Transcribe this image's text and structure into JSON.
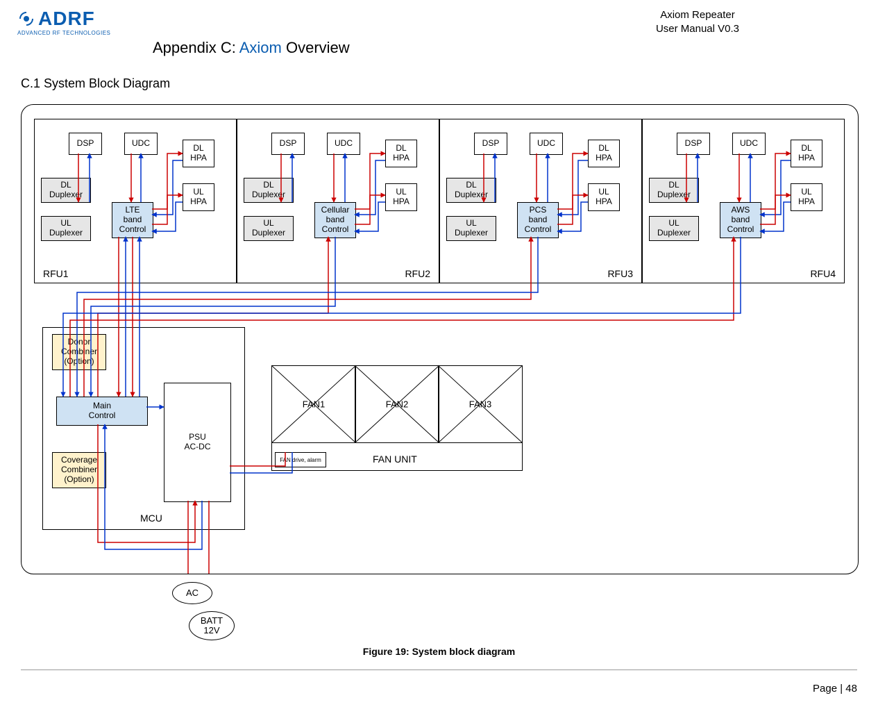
{
  "header": {
    "brand": "ADRF",
    "brand_tag": "ADVANCED RF TECHNOLOGIES",
    "doc_title": "Axiom Repeater",
    "doc_subtitle": "User Manual V0.3"
  },
  "appendix": {
    "prefix": "Appendix C: ",
    "highlight": "Axiom",
    "suffix": " Overview"
  },
  "section": {
    "title": "C.1 System Block Diagram"
  },
  "rfu_common": {
    "dsp": "DSP",
    "udc": "UDC",
    "dl_hpa": "DL\nHPA",
    "ul_hpa": "UL\nHPA",
    "dl_dup": "DL\nDuplexer",
    "ul_dup": "UL\nDuplexer"
  },
  "rfu": [
    {
      "label": "RFU1",
      "band_control": "LTE\nband\nControl"
    },
    {
      "label": "RFU2",
      "band_control": "Cellular\nband\nControl"
    },
    {
      "label": "RFU3",
      "band_control": "PCS\nband\nControl"
    },
    {
      "label": "RFU4",
      "band_control": "AWS\nband\nControl"
    }
  ],
  "mcu": {
    "label": "MCU",
    "donor_combiner": "Donor\nCombiner\n(Option)",
    "main_control": "Main\nControl",
    "coverage_combiner": "Coverage\nCombiner\n(Option)",
    "psu": "PSU\nAC-DC"
  },
  "fan": {
    "unit_label": "FAN UNIT",
    "fans": [
      "FAN1",
      "FAN2",
      "FAN3"
    ],
    "drive_label": "FAN drive, alarm"
  },
  "power": {
    "ac": "AC",
    "batt": "BATT\n12V"
  },
  "figure_caption": "Figure 19: System block diagram",
  "footer": "Page | 48"
}
